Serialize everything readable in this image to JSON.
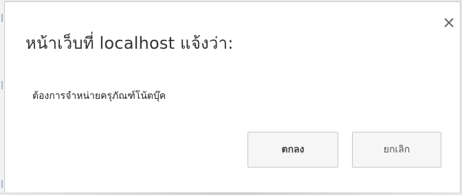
{
  "dialog": {
    "title": "หน้าเว็บที่ localhost แจ้งว่า:",
    "message": "ต้องการจำหน่ายครุภัณฑ์โน้ตบุ๊ค",
    "close_icon": "close-icon",
    "buttons": {
      "ok_label": "ตกลง",
      "cancel_label": "ยกเลิก"
    }
  },
  "colors": {
    "background": "#ffffff",
    "button_bg": "#f6f6f6",
    "button_border": "#c6c6c6",
    "text": "#333333"
  }
}
